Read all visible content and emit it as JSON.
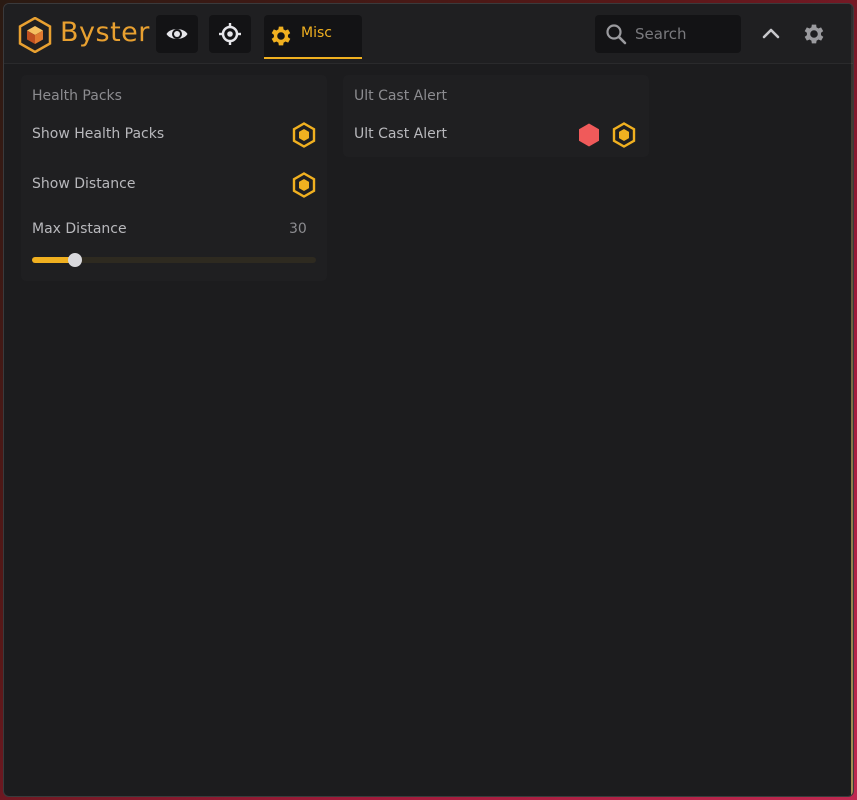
{
  "app": {
    "brand": "Byster",
    "accent_color": "#f0b020",
    "brand_color": "#e8a030"
  },
  "header": {
    "tabs": [
      {
        "icon": "eye-icon",
        "label": ""
      },
      {
        "icon": "crosshair-icon",
        "label": ""
      },
      {
        "icon": "gear-icon",
        "label": "Misc",
        "active": true
      }
    ],
    "search": {
      "placeholder": "Search",
      "value": ""
    },
    "collapse_icon": "chevron-up-icon",
    "settings_icon": "gear-icon"
  },
  "panels": {
    "health_packs": {
      "title": "Health Packs",
      "rows": [
        {
          "label": "Show Health Packs",
          "toggle_icon": "hexagon-outline-icon",
          "toggle_color": "#f0b020"
        },
        {
          "label": "Show Distance",
          "toggle_icon": "hexagon-outline-icon",
          "toggle_color": "#f0b020"
        }
      ],
      "slider": {
        "label": "Max Distance",
        "value": "30",
        "fraction": 0.15
      }
    },
    "ult_cast_alert": {
      "title": "Ult Cast Alert",
      "rows": [
        {
          "label": "Ult Cast Alert",
          "color_icon": "hexagon-filled-icon",
          "color_value": "#f05a5a",
          "toggle_icon": "hexagon-outline-icon",
          "toggle_color": "#f0b020"
        }
      ]
    }
  }
}
